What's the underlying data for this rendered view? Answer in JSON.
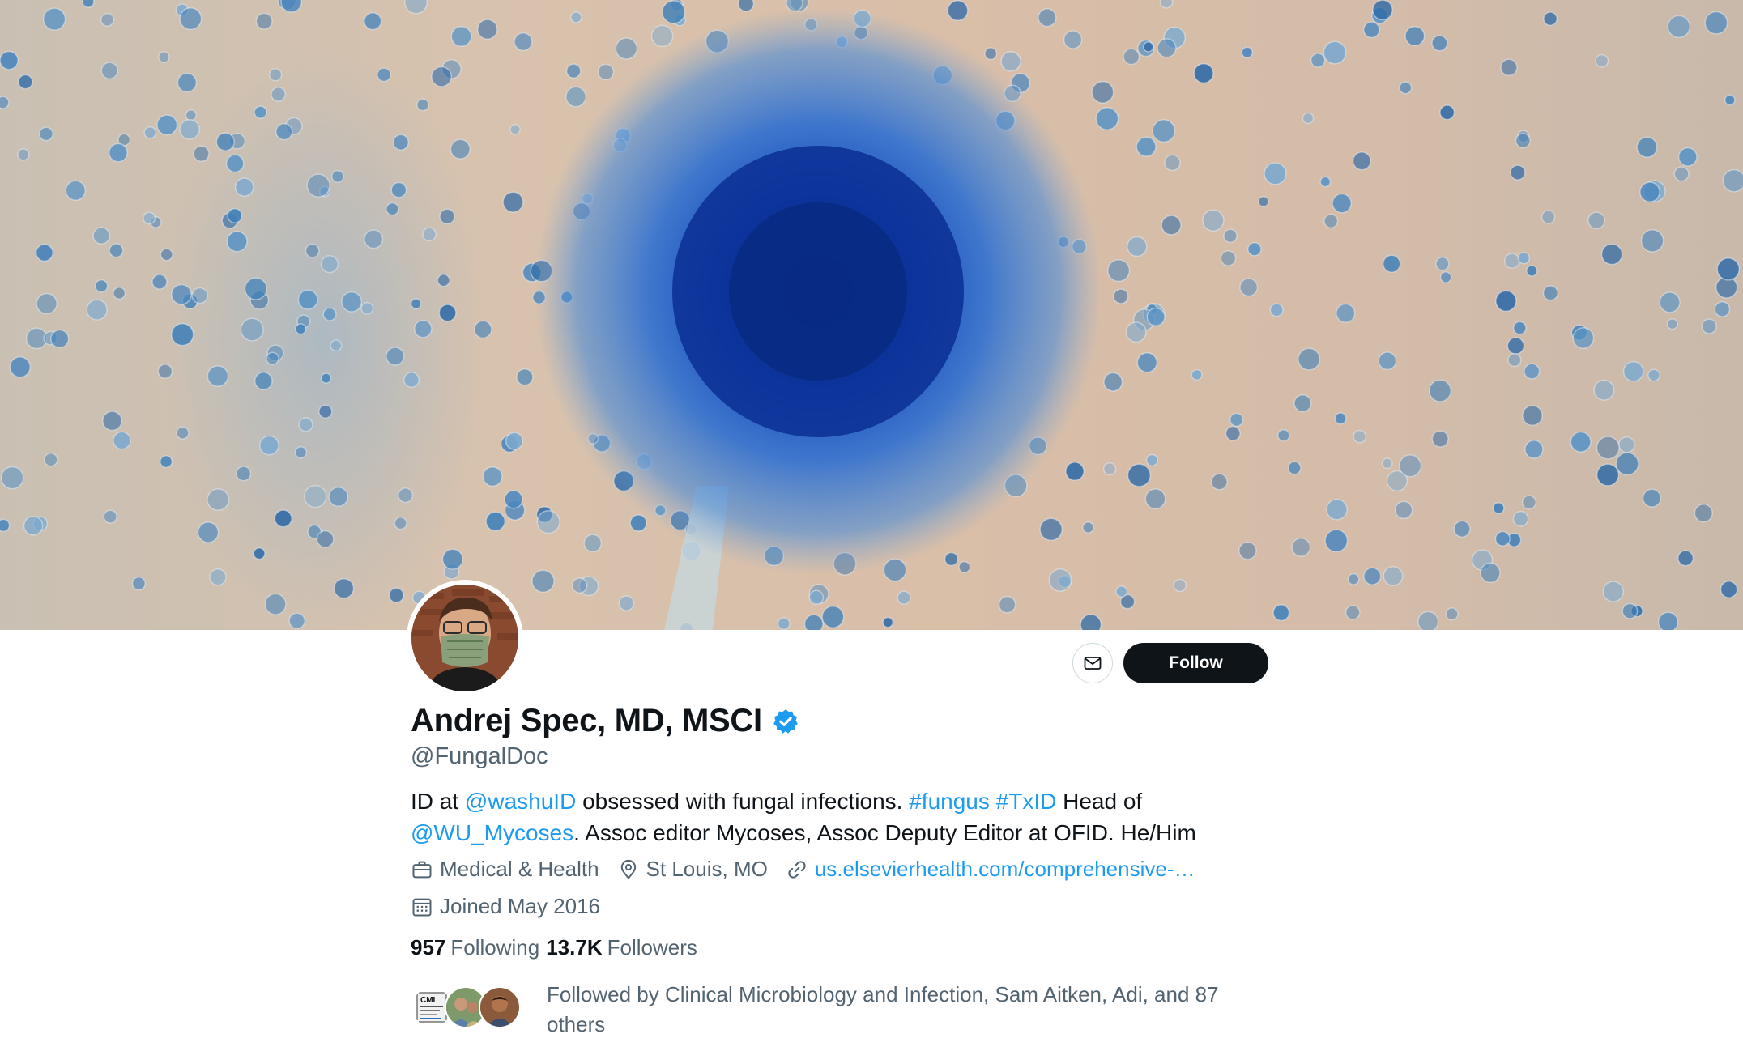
{
  "profile": {
    "display_name": "Andrej Spec, MD, MSCI",
    "handle": "@FungalDoc",
    "verified": true,
    "bio": {
      "part1": "ID at ",
      "mention1": "@washuID",
      "part2": " obsessed with fungal infections. ",
      "hashtag1": "#fungus",
      "space": " ",
      "hashtag2": "#TxID",
      "part3": " Head of ",
      "mention2": "@WU_Mycoses",
      "part4": ". Assoc editor Mycoses, Assoc Deputy Editor at OFID. He/Him"
    },
    "category": "Medical & Health",
    "location": "St Louis, MO",
    "url": "us.elsevierhealth.com/comprehensive-…",
    "joined": "Joined May 2016",
    "following_count": "957",
    "following_label": "Following",
    "followers_count": "13.7K",
    "followers_label": "Followers",
    "followed_by": "Followed by Clinical Microbiology and Infection, Sam Aitken, Adi, and 87 others",
    "cmi_logo_text": "CMI CLINICAL MICROBIOLOGY AND INFECTION"
  },
  "actions": {
    "follow_label": "Follow"
  },
  "icons": {
    "message": "envelope-icon",
    "verified": "verified-badge-icon",
    "category": "briefcase-icon",
    "location": "location-pin-icon",
    "link": "link-icon",
    "calendar": "calendar-icon"
  },
  "colors": {
    "accent": "#1d9bf0",
    "text_primary": "#0f1419",
    "text_secondary": "#536471",
    "follow_button": "#0f1419"
  }
}
